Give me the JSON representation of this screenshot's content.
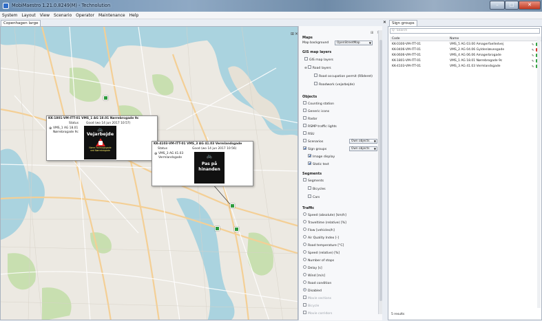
{
  "window": {
    "title": "MobiMaestro 1.21.0.8249(M) - Technolution",
    "minimize": "–",
    "maximize": "□",
    "close": "✕"
  },
  "menu": [
    "System",
    "Layout",
    "View",
    "Scenario",
    "Operator",
    "Maintenance",
    "Help"
  ],
  "tabs": {
    "map": "Copenhagen large",
    "sign_groups": "Sign groups"
  },
  "popups": [
    {
      "title": "KK-1801-VM-ITT-01 VMS_1 AG 18.01 Nørrebrogade 9c",
      "status_label": "Status",
      "status_value": "Good (wo 14 jun 2017 10:57)",
      "item_line1": "VMS_1 AG 18.01",
      "item_line2": "Nørrebrogade 9c",
      "sign_text": "Vejarbejde",
      "sign_sub1": "Nørre Farimagsgade",
      "sign_sub2": "ved Nørrebrogade"
    },
    {
      "title": "KK-4103-VM-ITT-01 VMS_3 AG 41.03 Vermlandsgade",
      "status_label": "Status",
      "status_value": "Good (wo 14 jun 2017 10:56)",
      "item_line1": "VMS_3 AG 41.03",
      "item_line2": "Vermlandsgade",
      "sign_line1": "Pas på",
      "sign_line2": "hinanden"
    }
  ],
  "panel": {
    "maps": {
      "header": "Maps",
      "background_label": "Map background",
      "background_value": "OpenStreetMap"
    },
    "gis": {
      "header": "GIS map layers",
      "items": [
        "GIS map layers",
        "Road layers",
        "Road occupation permit (Råderet)",
        "Roadwork (vejarbejde)"
      ]
    },
    "objects": {
      "header": "Objects",
      "items": [
        "Counting station",
        "Generic icons",
        "Radar",
        "RSMP traffic lights",
        "RSU",
        "Scenarios",
        "Sign groups",
        "Image display",
        "Static text"
      ],
      "own_objects": "Own objects"
    },
    "segments": {
      "header": "Segments",
      "items": [
        "Segments",
        "Bicycles",
        "Cars"
      ]
    },
    "traffic": {
      "header": "Traffic",
      "items": [
        "Speed (absolute) [km/h]",
        "Traveltime (relative) [%]",
        "Flow [vehicles/h]",
        "Air Quality Index [-]",
        "Road temperature [°C]",
        "Speed (relative) [%]",
        "Number of stops",
        "Delay [s]",
        "Wind [m/s]",
        "Road condition",
        "Disabled",
        "Movie sections",
        "Bicycle",
        "Movie corridors"
      ]
    }
  },
  "sign_groups": {
    "search_placeholder": "Q- Search",
    "col_code": "Code",
    "col_name": "Name",
    "rows": [
      {
        "code": "KK-0300-VM-ITT-01",
        "name": "VMS_5 AG 03.00 Amagerfaelledvej",
        "status": "green"
      },
      {
        "code": "KK-0406-VM-ITT-01",
        "name": "VMS_2 AG 04.06 Gyldenlævesgade",
        "status": "red"
      },
      {
        "code": "KK-0606-VM-ITT-01",
        "name": "VMS_4 AG 06.06 Amagerbrogade",
        "status": "green"
      },
      {
        "code": "KK-1801-VM-ITT-01",
        "name": "VMS_1 AG 18.01 Nørrebrogade 9c",
        "status": "green"
      },
      {
        "code": "KK-4103-VM-ITT-01",
        "name": "VMS_3 AG 41.03 Vermlandsgade",
        "status": "green"
      }
    ],
    "footer": "5 results"
  },
  "colors": {
    "water": "#aad3df",
    "park": "#c8dfb0",
    "road_major": "#f7d8a0",
    "status_green": "#33a343",
    "status_red": "#d8342a"
  }
}
